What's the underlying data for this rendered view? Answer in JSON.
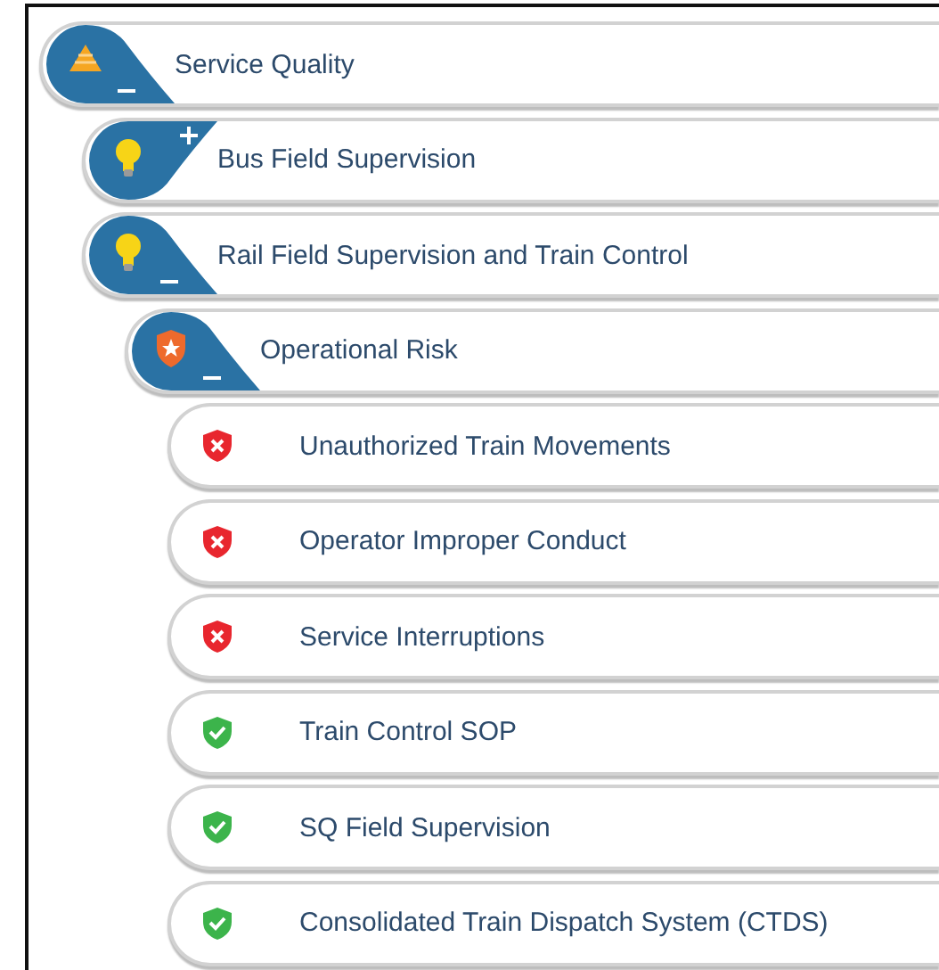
{
  "tree": [
    {
      "label": "Service Quality",
      "kind": "warning",
      "expanded": true,
      "children": [
        {
          "label": "Bus Field Supervision",
          "kind": "bulb",
          "expanded": false
        },
        {
          "label": "Rail Field Supervision and Train Control",
          "kind": "bulb",
          "expanded": true,
          "children": [
            {
              "label": "Operational Risk",
              "kind": "shield",
              "expanded": true,
              "children": [
                {
                  "label": "Unauthorized Train Movements",
                  "kind": "fail"
                },
                {
                  "label": "Operator Improper Conduct",
                  "kind": "fail"
                },
                {
                  "label": "Service Interruptions",
                  "kind": "fail"
                },
                {
                  "label": "Train Control SOP",
                  "kind": "pass"
                },
                {
                  "label": "SQ Field Supervision",
                  "kind": "pass"
                },
                {
                  "label": "Consolidated Train Dispatch System (CTDS)",
                  "kind": "pass"
                }
              ]
            }
          ]
        }
      ]
    }
  ]
}
